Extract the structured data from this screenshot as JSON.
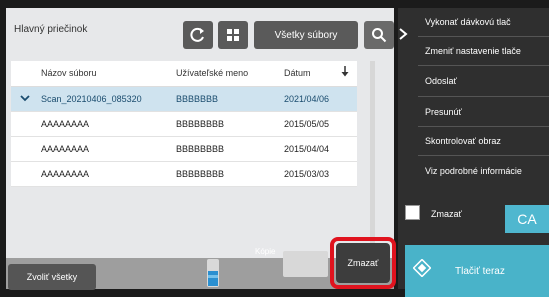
{
  "header": {
    "folder_title": "Hlavný priečinok",
    "all_files_label": "Všetky súbory"
  },
  "table": {
    "columns": [
      "Názov súboru",
      "Užívateľské meno",
      "Dátum"
    ],
    "rows": [
      {
        "name": "Scan_20210406_085320",
        "user": "BBBBBBB",
        "date": "2021/04/06",
        "selected": true
      },
      {
        "name": "AAAAAAAA",
        "user": "BBBBBBBB",
        "date": "2015/05/05",
        "selected": false
      },
      {
        "name": "AAAAAAAA",
        "user": "BBBBBBBB",
        "date": "2015/04/04",
        "selected": false
      },
      {
        "name": "AAAAAAAA",
        "user": "BBBBBBBB",
        "date": "2015/03/03",
        "selected": false
      }
    ]
  },
  "bottom": {
    "select_all_label": "Zvoliť všetky",
    "copies_label": "Kópie",
    "delete_label": "Zmazať"
  },
  "side_menu": {
    "items": [
      "Vykonať dávkovú tlač",
      "Zmeniť nastavenie tlače",
      "Odoslať",
      "Presunúť",
      "Skontrolovať obraz",
      "Viz podrobné informácie"
    ],
    "checkbox_label": "Zmazať",
    "ca_label": "CA",
    "print_now_label": "Tlačiť teraz"
  },
  "colors": {
    "accent": "#49b3c9",
    "highlight": "#e0131e"
  }
}
